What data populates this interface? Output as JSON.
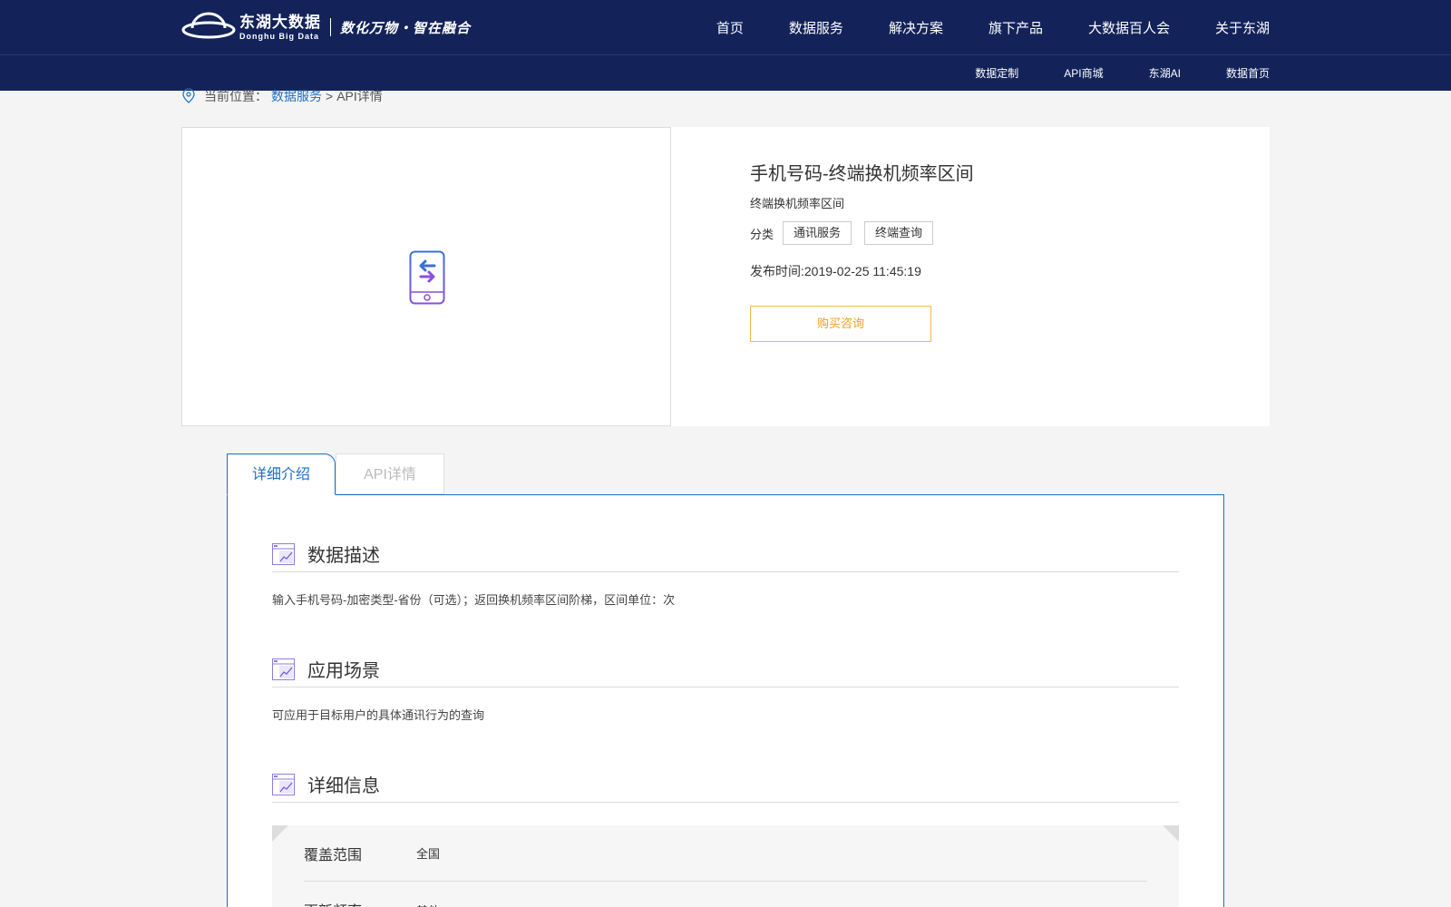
{
  "header": {
    "logo_cn": "东湖大数据",
    "logo_en": "Donghu Big Data",
    "slogan": "数化万物・智在融合",
    "main_nav": [
      "首页",
      "数据服务",
      "解决方案",
      "旗下产品",
      "大数据百人会",
      "关于东湖"
    ],
    "sub_nav": [
      "数据定制",
      "API商城",
      "东湖AI",
      "数据首页"
    ]
  },
  "breadcrumb": {
    "prefix": "当前位置：",
    "link": "数据服务",
    "separator": ">",
    "current": "API详情"
  },
  "product": {
    "title": "手机号码-终端换机频率区间",
    "subtitle": "终端换机频率区间",
    "category_label": "分类",
    "tags": [
      "通讯服务",
      "终端查询"
    ],
    "publish_time": "发布时间:2019-02-25 11:45:19",
    "buy_button": "购买咨询"
  },
  "tabs": [
    "详细介绍",
    "API详情"
  ],
  "sections": [
    {
      "title": "数据描述",
      "body": "输入手机号码-加密类型-省份（可选）；返回换机频率区间阶梯，区间单位：次"
    },
    {
      "title": "应用场景",
      "body": "可应用于目标用户的具体通讯行为的查询"
    },
    {
      "title": "详细信息",
      "body": ""
    }
  ],
  "details": [
    {
      "key": "覆盖范围",
      "value": "全国"
    },
    {
      "key": "更新频率",
      "value": "其他"
    }
  ],
  "colors": {
    "header_bg": "#13235a",
    "link_blue": "#1a6fc4",
    "button_orange": "#f0a020",
    "icon_purple": "#7a5be0"
  }
}
